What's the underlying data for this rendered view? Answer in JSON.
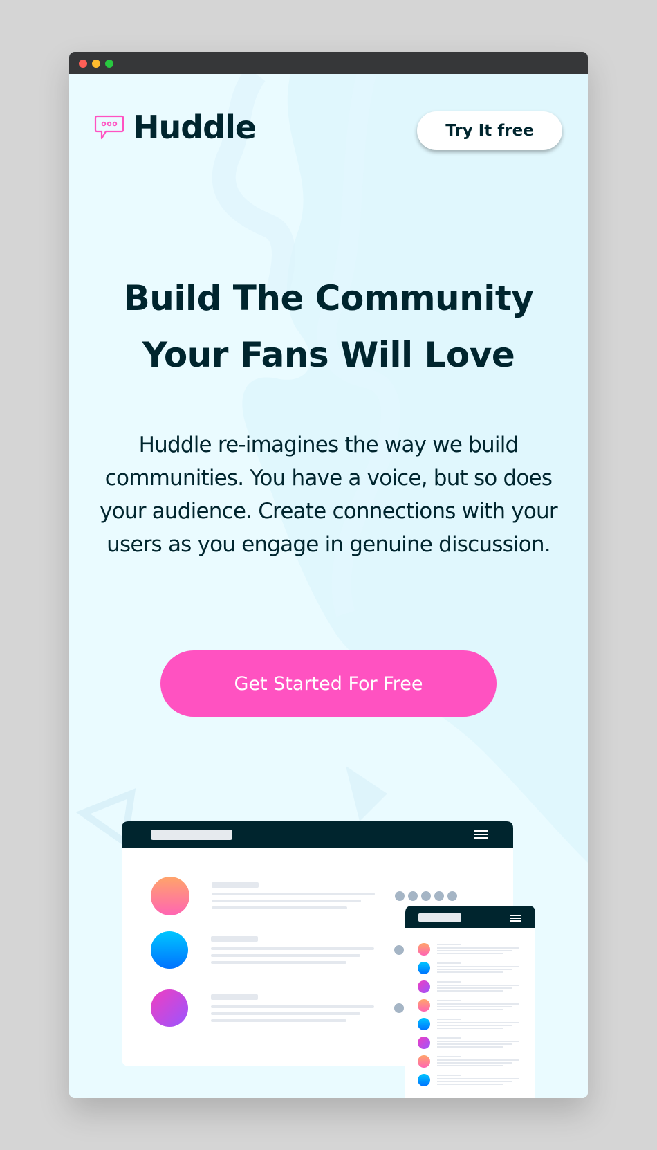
{
  "window": {
    "controls": [
      "close",
      "minimize",
      "maximize"
    ]
  },
  "header": {
    "brand_name": "Huddle",
    "logo_icon": "speech-bubble-icon",
    "cta_label": "Try It free"
  },
  "hero": {
    "headline": "Build The Community Your Fans Will Love",
    "description": "Huddle re-imagines the way we build communities. You have a voice, but so does your audience. Create connections with your users as you engage in genuine discussion.",
    "cta_label": "Get Started For Free"
  },
  "colors": {
    "dark_cyan": "#00252e",
    "pink": "#ff52c1",
    "background": "#eafbff",
    "white": "#ffffff"
  },
  "illustration": {
    "name": "app-mockup-illustration",
    "menu_icon": "hamburger-menu-icon",
    "desktop_rows": 3,
    "mobile_rows": 8
  }
}
